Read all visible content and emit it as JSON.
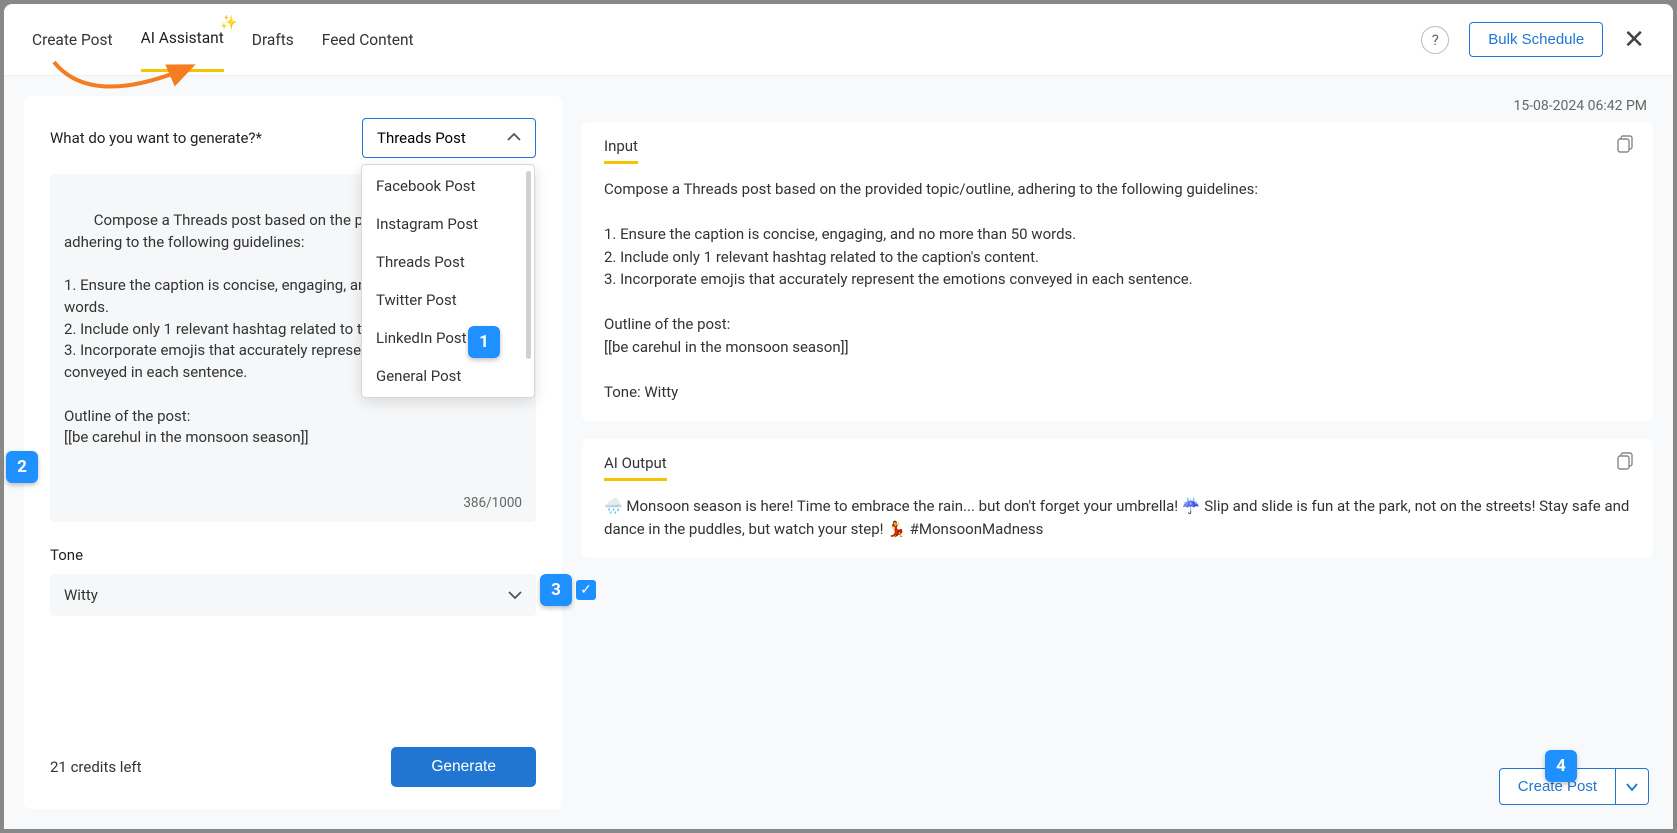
{
  "tabs": {
    "create": "Create Post",
    "ai": "AI Assistant",
    "drafts": "Drafts",
    "feed": "Feed Content"
  },
  "topbar": {
    "help_tooltip": "?",
    "bulk_label": "Bulk Schedule"
  },
  "left": {
    "generate_label": "What do you want to generate?*",
    "select_value": "Threads Post",
    "dropdown": [
      "Facebook Post",
      "Instagram Post",
      "Threads Post",
      "Twitter Post",
      "LinkedIn Post",
      "General Post"
    ],
    "prompt_text": "Compose a Threads post based on the provided topic/outline, adhering to the following guidelines:\n\n1. Ensure the caption is concise, engaging, and no more than 50 words.\n2. Include only 1 relevant hashtag related to the caption's content.\n3. Incorporate emojis that accurately represent the emotions conveyed in each sentence.\n\nOutline of the post:\n[[be carehul in the monsoon season]]",
    "char_count": "386/1000",
    "tone_label": "Tone",
    "tone_value": "Witty",
    "credits": "21 credits left",
    "generate_btn": "Generate"
  },
  "right": {
    "timestamp": "15-08-2024 06:42 PM",
    "input_title": "Input",
    "input_body": "Compose a Threads post based on the provided topic/outline, adhering to the following guidelines:\n\n1. Ensure the caption is concise, engaging, and no more than 50 words.\n2. Include only 1 relevant hashtag related to the caption's content.\n3. Incorporate emojis that accurately represent the emotions conveyed in each sentence.\n\nOutline of the post:\n[[be carehul in the monsoon season]]\n\nTone: Witty",
    "output_title": "AI Output",
    "output_body": "🌧️ Monsoon season is here! Time to embrace the rain... but don't forget your umbrella! ☔ Slip and slide is fun at the park, not on the streets! Stay safe and dance in the puddles, but watch your step! 💃 #MonsoonMadness",
    "create_post_btn": "Create Post"
  },
  "annotations": {
    "a1": "1",
    "a2": "2",
    "a3": "3",
    "a4": "4"
  }
}
